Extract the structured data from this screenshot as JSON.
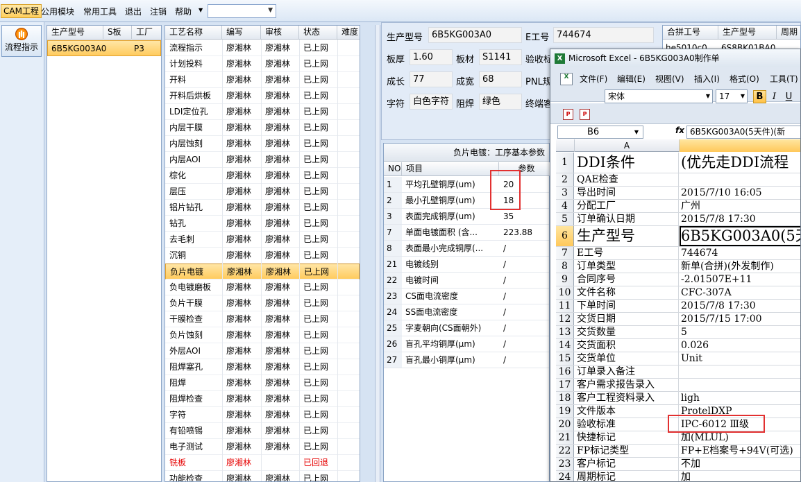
{
  "menubar": {
    "items": [
      "CAM工程",
      "公用模块",
      "常用工具",
      "退出",
      "注销",
      "帮助"
    ],
    "combo_value": ""
  },
  "nav": {
    "flow_button": "流程指示"
  },
  "grid1": {
    "headers": [
      "生产型号",
      "S板",
      "工厂"
    ],
    "rows": [
      [
        "6B5KG003A0",
        "",
        "P3"
      ]
    ]
  },
  "grid2": {
    "headers": [
      "工艺名称",
      "编写",
      "审核",
      "状态",
      "难度"
    ],
    "rows": [
      [
        "流程指示",
        "廖湘林",
        "廖湘林",
        "已上网"
      ],
      [
        "计划投料",
        "廖湘林",
        "廖湘林",
        "已上网"
      ],
      [
        "开料",
        "廖湘林",
        "廖湘林",
        "已上网"
      ],
      [
        "开料后烘板",
        "廖湘林",
        "廖湘林",
        "已上网"
      ],
      [
        "LDI定位孔",
        "廖湘林",
        "廖湘林",
        "已上网"
      ],
      [
        "内层干膜",
        "廖湘林",
        "廖湘林",
        "已上网"
      ],
      [
        "内层蚀刻",
        "廖湘林",
        "廖湘林",
        "已上网"
      ],
      [
        "内层AOI",
        "廖湘林",
        "廖湘林",
        "已上网"
      ],
      [
        "棕化",
        "廖湘林",
        "廖湘林",
        "已上网"
      ],
      [
        "层压",
        "廖湘林",
        "廖湘林",
        "已上网"
      ],
      [
        "铝片钻孔",
        "廖湘林",
        "廖湘林",
        "已上网"
      ],
      [
        "钻孔",
        "廖湘林",
        "廖湘林",
        "已上网"
      ],
      [
        "去毛刺",
        "廖湘林",
        "廖湘林",
        "已上网"
      ],
      [
        "沉铜",
        "廖湘林",
        "廖湘林",
        "已上网"
      ],
      [
        "负片电镀",
        "廖湘林",
        "廖湘林",
        "已上网"
      ],
      [
        "负电镀磨板",
        "廖湘林",
        "廖湘林",
        "已上网"
      ],
      [
        "负片干膜",
        "廖湘林",
        "廖湘林",
        "已上网"
      ],
      [
        "干膜检查",
        "廖湘林",
        "廖湘林",
        "已上网"
      ],
      [
        "负片蚀刻",
        "廖湘林",
        "廖湘林",
        "已上网"
      ],
      [
        "外层AOI",
        "廖湘林",
        "廖湘林",
        "已上网"
      ],
      [
        "阻焊塞孔",
        "廖湘林",
        "廖湘林",
        "已上网"
      ],
      [
        "阻焊",
        "廖湘林",
        "廖湘林",
        "已上网"
      ],
      [
        "阻焊检查",
        "廖湘林",
        "廖湘林",
        "已上网"
      ],
      [
        "字符",
        "廖湘林",
        "廖湘林",
        "已上网"
      ],
      [
        "有铅喷锡",
        "廖湘林",
        "廖湘林",
        "已上网"
      ],
      [
        "电子测试",
        "廖湘林",
        "廖湘林",
        "已上网"
      ],
      [
        "铣板",
        "廖湘林",
        "",
        "已回退"
      ],
      [
        "功能检查",
        "廖湘林",
        "廖湘林",
        "已上网"
      ]
    ],
    "selected_index": 14,
    "red_index": 26
  },
  "form": {
    "model_label": "生产型号",
    "model_value": "6B5KG003A0",
    "eno_label": "E工号",
    "eno_value": "744674",
    "thick_label": "板厚",
    "thick_value": "1.60",
    "material_label": "板材",
    "material_value": "S1141",
    "accept_label": "验收标",
    "len_label": "成长",
    "len_value": "77",
    "width_label": "成宽",
    "width_value": "68",
    "pnl_label": "PNL规",
    "char_label": "字符",
    "char_value": "白色字符",
    "mask_label": "阻焊",
    "mask_value": "绿色",
    "end_label": "终端客"
  },
  "grid3": {
    "headers": [
      "合拼工号",
      "生产型号",
      "周期"
    ],
    "row": [
      "he5010c0",
      "6S8BK01BA0",
      ""
    ]
  },
  "params": {
    "title": "负片电镀：工序基本参数",
    "headers": [
      "NO",
      "项目",
      "参数"
    ],
    "rows": [
      [
        "1",
        "平均孔壁铜厚(um)",
        "20"
      ],
      [
        "2",
        "最小孔壁铜厚(um)",
        "18"
      ],
      [
        "3",
        "表面完成铜厚(um)",
        "35"
      ],
      [
        "7",
        "单面电镀面积 (含...",
        "223.88"
      ],
      [
        "8",
        "表面最小完成铜厚(...",
        "/"
      ],
      [
        "21",
        "电镀线别",
        "/"
      ],
      [
        "22",
        "电镀时间",
        "/"
      ],
      [
        "23",
        "CS面电流密度",
        "/"
      ],
      [
        "24",
        "SS面电流密度",
        "/"
      ],
      [
        "25",
        "字麦朝向(CS面朝外)",
        "/"
      ],
      [
        "26",
        "盲孔平均铜厚(μm)",
        "/"
      ],
      [
        "27",
        "盲孔最小铜厚(μm)",
        "/"
      ]
    ]
  },
  "excel": {
    "title": "Microsoft Excel - 6B5KG003A0制作单",
    "menu": [
      "文件(F)",
      "编辑(E)",
      "视图(V)",
      "插入(I)",
      "格式(O)",
      "工具(T)"
    ],
    "font_name": "宋体",
    "font_size": "17",
    "bold": "B",
    "italic": "I",
    "underline": "U",
    "name_box": "B6",
    "fx": "fx",
    "formula": "6B5KG003A0(5天件)(新",
    "col_a": "A",
    "rows": [
      [
        "1",
        "DDI条件",
        "(优先走DDI流程"
      ],
      [
        "2",
        "QAE检查",
        ""
      ],
      [
        "3",
        "导出时间",
        "2015/7/10 16:05"
      ],
      [
        "4",
        "分配工厂",
        "广州"
      ],
      [
        "5",
        "订单确认日期",
        "2015/7/8 17:30"
      ],
      [
        "6",
        "生产型号",
        "6B5KG003A0(5天"
      ],
      [
        "7",
        "E工号",
        "744674"
      ],
      [
        "8",
        "订单类型",
        "新单(合拼)(外发制作)"
      ],
      [
        "9",
        "合同序号",
        "-2.01507E+11"
      ],
      [
        "10",
        "文件名称",
        "CFC-307A"
      ],
      [
        "11",
        "下单时间",
        "2015/7/8 17:30"
      ],
      [
        "12",
        "交货日期",
        "2015/7/15 17:00"
      ],
      [
        "13",
        "交货数量",
        "5"
      ],
      [
        "14",
        "交货面积",
        "0.026"
      ],
      [
        "15",
        "交货单位",
        "Unit"
      ],
      [
        "16",
        "订单录入备注",
        ""
      ],
      [
        "17",
        "客户需求报告录入",
        ""
      ],
      [
        "18",
        "客户工程资料录入",
        "ligh"
      ],
      [
        "19",
        "文件版本",
        "ProtelDXP"
      ],
      [
        "20",
        "验收标准",
        "IPC-6012 Ⅲ级"
      ],
      [
        "21",
        "快捷标记",
        "加(MLUL)"
      ],
      [
        "22",
        "FP标记类型",
        "FP+E档案号+94V(可选)"
      ],
      [
        "23",
        "客户标记",
        "不加"
      ],
      [
        "24",
        "周期标记",
        "加"
      ]
    ]
  }
}
